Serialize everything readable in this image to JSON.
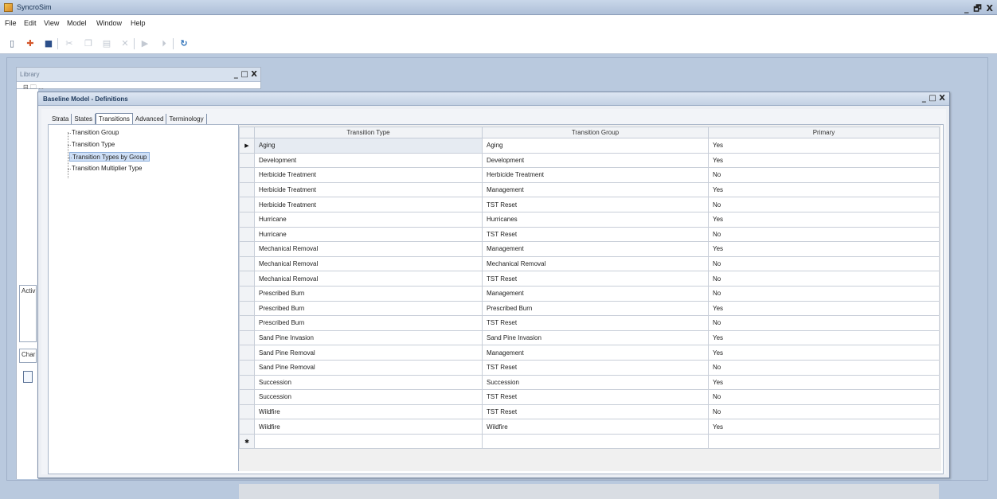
{
  "app": {
    "title": "SyncroSim",
    "window_controls": "_ 🗗 X"
  },
  "menu": [
    "File",
    "Edit",
    "View",
    "Model",
    "Window",
    "Help"
  ],
  "toolbar": [
    {
      "icon": "open-icon",
      "glyph": "▯",
      "enabled": true
    },
    {
      "icon": "add-icon",
      "glyph": "✚",
      "enabled": true
    },
    {
      "icon": "save-icon",
      "glyph": "■",
      "enabled": true
    },
    {
      "icon": "cut-icon",
      "glyph": "✂",
      "enabled": false
    },
    {
      "icon": "copy-icon",
      "glyph": "❐",
      "enabled": false
    },
    {
      "icon": "paste-icon",
      "glyph": "▤",
      "enabled": false
    },
    {
      "icon": "delete-icon",
      "glyph": "✕",
      "enabled": false
    },
    {
      "icon": "run-icon",
      "glyph": "▶",
      "enabled": false
    },
    {
      "icon": "run-step-icon",
      "glyph": "⏵",
      "enabled": false
    },
    {
      "icon": "refresh-icon",
      "glyph": "↻",
      "enabled": true
    }
  ],
  "library_panel": {
    "title": "Library",
    "controls": "_ □ X",
    "tree_root": "⊟ 🗀 ..."
  },
  "side_panels": {
    "activities_label": "Activ",
    "charts_label": "Char"
  },
  "dialog": {
    "title": "Baseline Model - Definitions",
    "controls": "_ □ X",
    "tabs": [
      "Strata",
      "States",
      "Transitions",
      "Advanced",
      "Terminology"
    ],
    "active_tab": "Transitions",
    "tree": [
      "Transition Group",
      "Transition Type",
      "Transition Types by Group",
      "Transition Multiplier Type"
    ],
    "selected_tree_item": "Transition Types by Group",
    "grid": {
      "columns": [
        "Transition Type",
        "Transition Group",
        "Primary"
      ],
      "current_row_marker": "▶",
      "new_row_marker": "✱",
      "rows": [
        [
          "Aging",
          "Aging",
          "Yes"
        ],
        [
          "Development",
          "Development",
          "Yes"
        ],
        [
          "Herbicide Treatment",
          "Herbicide Treatment",
          "No"
        ],
        [
          "Herbicide Treatment",
          "Management",
          "Yes"
        ],
        [
          "Herbicide Treatment",
          "TST Reset",
          "No"
        ],
        [
          "Hurricane",
          "Hurricanes",
          "Yes"
        ],
        [
          "Hurricane",
          "TST Reset",
          "No"
        ],
        [
          "Mechanical Removal",
          "Management",
          "Yes"
        ],
        [
          "Mechanical Removal",
          "Mechanical Removal",
          "No"
        ],
        [
          "Mechanical Removal",
          "TST Reset",
          "No"
        ],
        [
          "Prescribed Burn",
          "Management",
          "No"
        ],
        [
          "Prescribed Burn",
          "Prescribed Burn",
          "Yes"
        ],
        [
          "Prescribed Burn",
          "TST Reset",
          "No"
        ],
        [
          "Sand Pine Invasion",
          "Sand Pine Invasion",
          "Yes"
        ],
        [
          "Sand Pine Removal",
          "Management",
          "Yes"
        ],
        [
          "Sand Pine Removal",
          "TST Reset",
          "No"
        ],
        [
          "Succession",
          "Succession",
          "Yes"
        ],
        [
          "Succession",
          "TST Reset",
          "No"
        ],
        [
          "Wildfire",
          "TST Reset",
          "No"
        ],
        [
          "Wildfire",
          "Wildfire",
          "Yes"
        ]
      ]
    }
  }
}
